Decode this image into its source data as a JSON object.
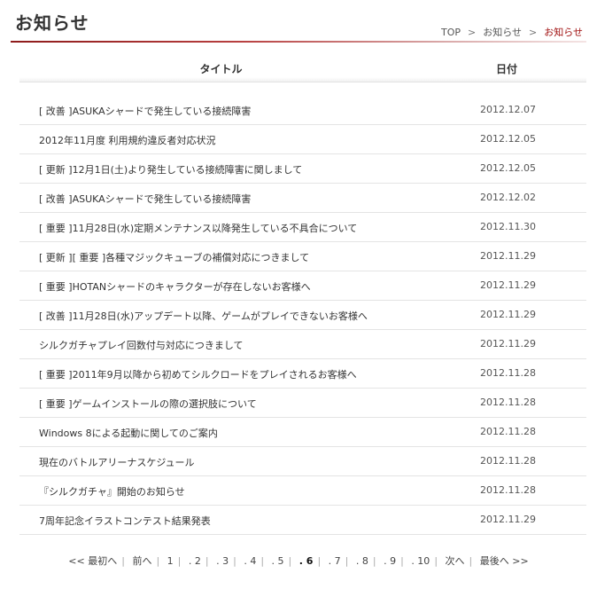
{
  "page": {
    "title": "お知らせ"
  },
  "breadcrumb": {
    "top": "TOP",
    "notice": "お知らせ",
    "current": "お知らせ",
    "sep": ">"
  },
  "table": {
    "headers": {
      "title": "タイトル",
      "date": "日付"
    },
    "rows": [
      {
        "title": "[ 改善 ]ASUKAシャードで発生している接続障害",
        "date": "2012.12.07"
      },
      {
        "title": "2012年11月度 利用規約違反者対応状況",
        "date": "2012.12.05"
      },
      {
        "title": "[ 更新 ]12月1日(土)より発生している接続障害に関しまして",
        "date": "2012.12.05"
      },
      {
        "title": "[ 改善 ]ASUKAシャードで発生している接続障害",
        "date": "2012.12.02"
      },
      {
        "title": "[ 重要 ]11月28日(水)定期メンテナンス以降発生している不具合について",
        "date": "2012.11.30"
      },
      {
        "title": "[ 更新 ][ 重要 ]各種マジックキューブの補償対応につきまして",
        "date": "2012.11.29"
      },
      {
        "title": "[ 重要 ]HOTANシャードのキャラクターが存在しないお客様へ",
        "date": "2012.11.29"
      },
      {
        "title": "[ 改善 ]11月28日(水)アップデート以降、ゲームがプレイできないお客様へ",
        "date": "2012.11.29"
      },
      {
        "title": "シルクガチャプレイ回数付与対応につきまして",
        "date": "2012.11.29"
      },
      {
        "title": "[ 重要 ]2011年9月以降から初めてシルクロードをプレイされるお客様へ",
        "date": "2012.11.28"
      },
      {
        "title": "[ 重要 ]ゲームインストールの際の選択肢について",
        "date": "2012.11.28"
      },
      {
        "title": "Windows 8による起動に関してのご案内",
        "date": "2012.11.28"
      },
      {
        "title": "現在のバトルアリーナスケジュール",
        "date": "2012.11.28"
      },
      {
        "title": "『シルクガチャ』開始のお知らせ",
        "date": "2012.11.28"
      },
      {
        "title": "7周年記念イラストコンテスト結果発表",
        "date": "2012.11.29"
      }
    ]
  },
  "pagination": {
    "first": "<< 最初へ",
    "prev": "前へ",
    "pages": [
      "1",
      ". 2",
      ". 3",
      ". 4",
      ". 5",
      ". 6",
      ". 7",
      ". 8",
      ". 9",
      ". 10"
    ],
    "current_index": 5,
    "next": "次へ",
    "last": "最後へ >>",
    "sep": "|"
  }
}
